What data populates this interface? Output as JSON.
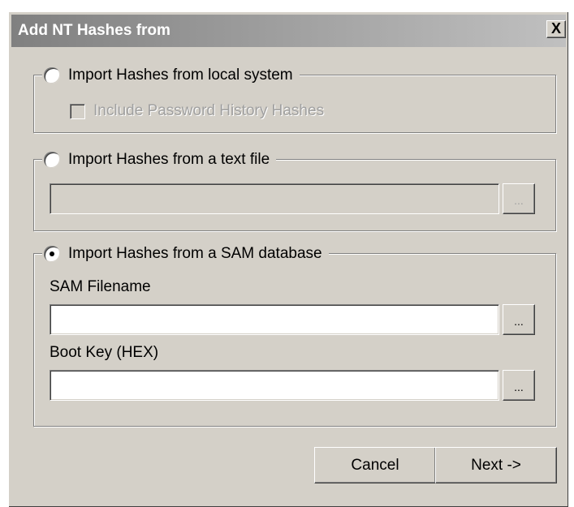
{
  "dialog": {
    "title": "Add NT Hashes from",
    "close_glyph": "X"
  },
  "local_system": {
    "radio_label": "Import Hashes from local system",
    "selected": false,
    "include_history_label": "Include Password History Hashes",
    "include_history_checked": false,
    "include_history_enabled": false
  },
  "text_file": {
    "radio_label": "Import Hashes from a text file",
    "selected": false,
    "path_value": "",
    "browse_label": "..."
  },
  "sam_database": {
    "radio_label": "Import Hashes from a SAM database",
    "selected": true,
    "sam_filename_label": "SAM Filename",
    "sam_filename_value": "",
    "sam_browse_label": "...",
    "boot_key_label": "Boot Key (HEX)",
    "boot_key_value": "",
    "boot_key_browse_label": "..."
  },
  "buttons": {
    "cancel_label": "Cancel",
    "next_label": "Next ->"
  },
  "icons": {
    "close": "close-icon",
    "radio": "radio-button",
    "checkbox": "checkbox"
  },
  "colors": {
    "dialog_face": "#d4d0c8",
    "title_gradient_start": "#808080",
    "title_gradient_end": "#c0c0c0",
    "title_text": "#ffffff",
    "disabled_text": "#a0a0a0"
  }
}
